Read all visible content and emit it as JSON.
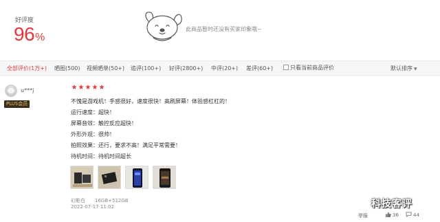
{
  "summary": {
    "rate_label": "好评度",
    "rate_value": "96",
    "rate_unit": "%",
    "no_impression_text": "此商品暂时还没有买家印象哦~"
  },
  "filters": {
    "items": [
      {
        "label": "全部评价(1万+)",
        "active": true
      },
      {
        "label": "晒图(500)",
        "active": false
      },
      {
        "label": "视频晒单(50+)",
        "active": false
      },
      {
        "label": "追评(100+)",
        "active": false
      },
      {
        "label": "好评(2800+)",
        "active": false
      },
      {
        "label": "中评(20+)",
        "active": false
      },
      {
        "label": "差评(60+)",
        "active": false
      }
    ],
    "current_only_label": "只看当前商品评价",
    "sort_label": "默认排序"
  },
  "review": {
    "username": "u***j",
    "badge": "PLUS会员",
    "rating": 5,
    "lines": [
      "不愧是游戏机！手感很好，速度很快！高刷屏幕！体验感杠杠的！",
      "运行速度：超快！",
      "屏幕音效：触控反应超快！",
      "外形外观：很帅！",
      "拍照效果：还行，要求不高！满足平常需要！",
      "待机时间：待机时间超长"
    ],
    "variant_color": "幻影白",
    "variant_spec": "16GB+512GB",
    "date": "2022-07-17 11:02",
    "report_label": "举报",
    "likes": "36",
    "replies": "44"
  },
  "watermark": "科技客评",
  "colors": {
    "accent": "#e4393c",
    "badge_bg": "#3b2f17",
    "badge_text": "#e7c47c"
  }
}
